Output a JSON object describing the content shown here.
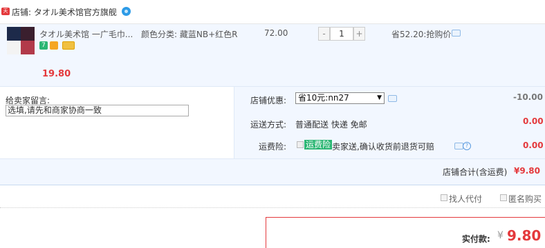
{
  "shop": {
    "tmall_badge": "天猫",
    "label": "店铺: タオル美术馆官方旗舰"
  },
  "item": {
    "title": "タオル美术馆 一广毛巾...",
    "sku": "颜色分类: 藏蓝NB+红色R",
    "price": "72.00",
    "quantity": "1",
    "qty_minus": "-",
    "qty_plus": "+",
    "promo": "省52.20:抢购价",
    "subtotal": "19.80",
    "badge_text": "7"
  },
  "message": {
    "label": "给卖家留言:",
    "placeholder": "选填,请先和商家协商一致"
  },
  "discount": {
    "label": "店铺优惠:",
    "selected": "省10元:nn27",
    "value": "-10.00"
  },
  "shipping": {
    "label": "运送方式:",
    "value": "普通配送 快递 免邮",
    "amount": "0.00"
  },
  "insurance": {
    "label": "运费险:",
    "tag": "运费险",
    "text": "卖家送,确认收货前退货可赔",
    "amount": "0.00",
    "help": "?"
  },
  "total": {
    "label": "店铺合计(含运费)",
    "value": "¥9.80"
  },
  "options": {
    "proxy_pay": "找人代付",
    "anonymous": "匿名购买"
  },
  "payment": {
    "label": "实付款:",
    "currency": "¥",
    "amount": "9.80"
  }
}
